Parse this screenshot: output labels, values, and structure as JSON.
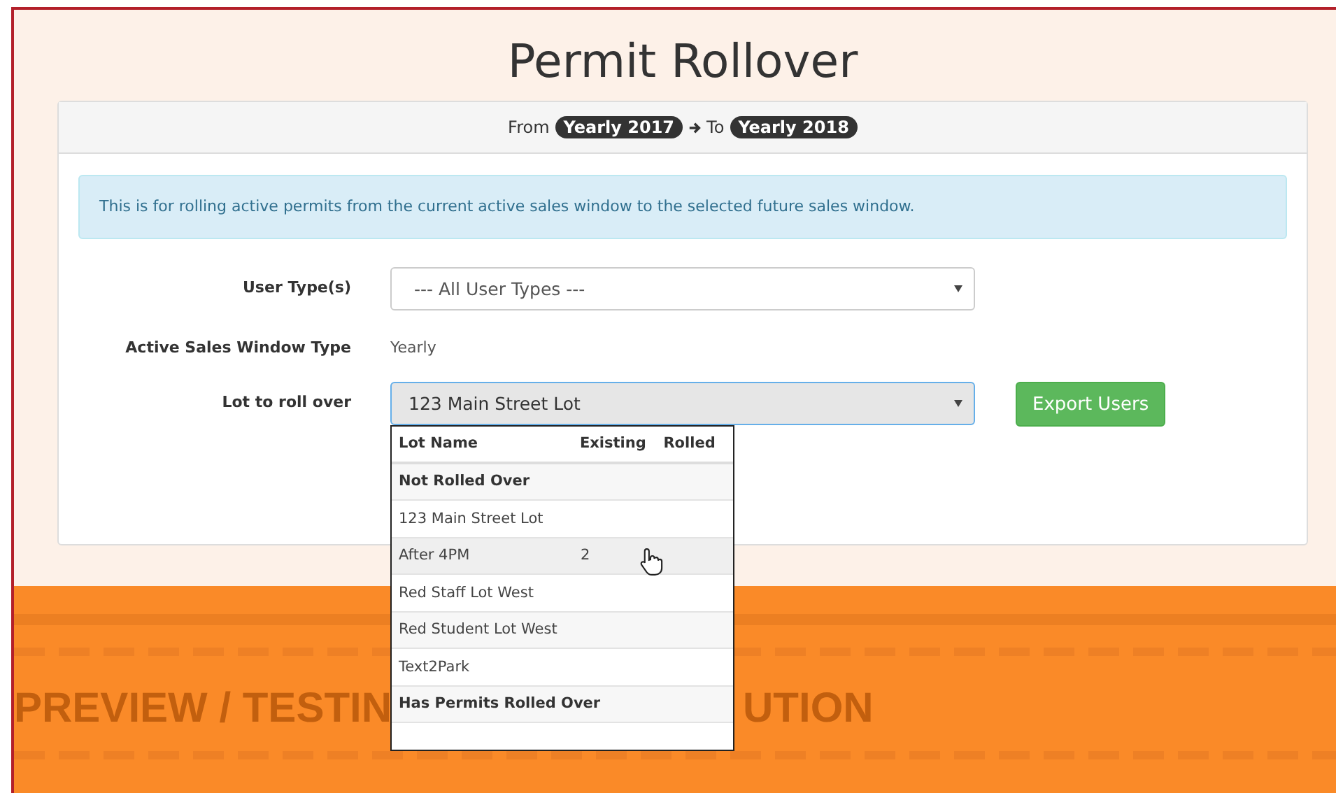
{
  "title": "Permit Rollover",
  "rollover": {
    "from_label": "From",
    "from": "Yearly 2017",
    "to_label": "To",
    "to": "Yearly 2018"
  },
  "alert": "This is for rolling active permits from the current active sales window to the selected future sales window.",
  "fields": [
    {
      "kind": "select",
      "label": "User Type(s)",
      "value": "--- All User Types ---",
      "focused": false
    },
    {
      "kind": "text",
      "label": "Active Sales Window Type",
      "value": "Yearly"
    },
    {
      "kind": "select",
      "label": "Lot to roll over",
      "value": "123 Main Street Lot",
      "focused": true
    }
  ],
  "export_button": "Export Users",
  "dropdown": {
    "columns": [
      "Lot Name",
      "Existing",
      "Rolled"
    ],
    "rows": [
      {
        "kind": "group",
        "name": "Not Rolled Over",
        "highlighted": false
      },
      {
        "kind": "option",
        "name": "123 Main Street Lot",
        "highlighted": false
      },
      {
        "kind": "option",
        "name": "After 4PM",
        "existing": "2",
        "highlighted": true
      },
      {
        "kind": "option",
        "name": "Red Staff Lot West",
        "highlighted": false
      },
      {
        "kind": "option",
        "name": "Red Student Lot West",
        "highlighted": false
      },
      {
        "kind": "option",
        "name": "Text2Park",
        "highlighted": false
      },
      {
        "kind": "group",
        "name": "Has Permits Rolled Over",
        "highlighted": false
      }
    ]
  },
  "banner": {
    "left_text": "PREVIEW / TESTIN",
    "right_text": "UTION"
  }
}
